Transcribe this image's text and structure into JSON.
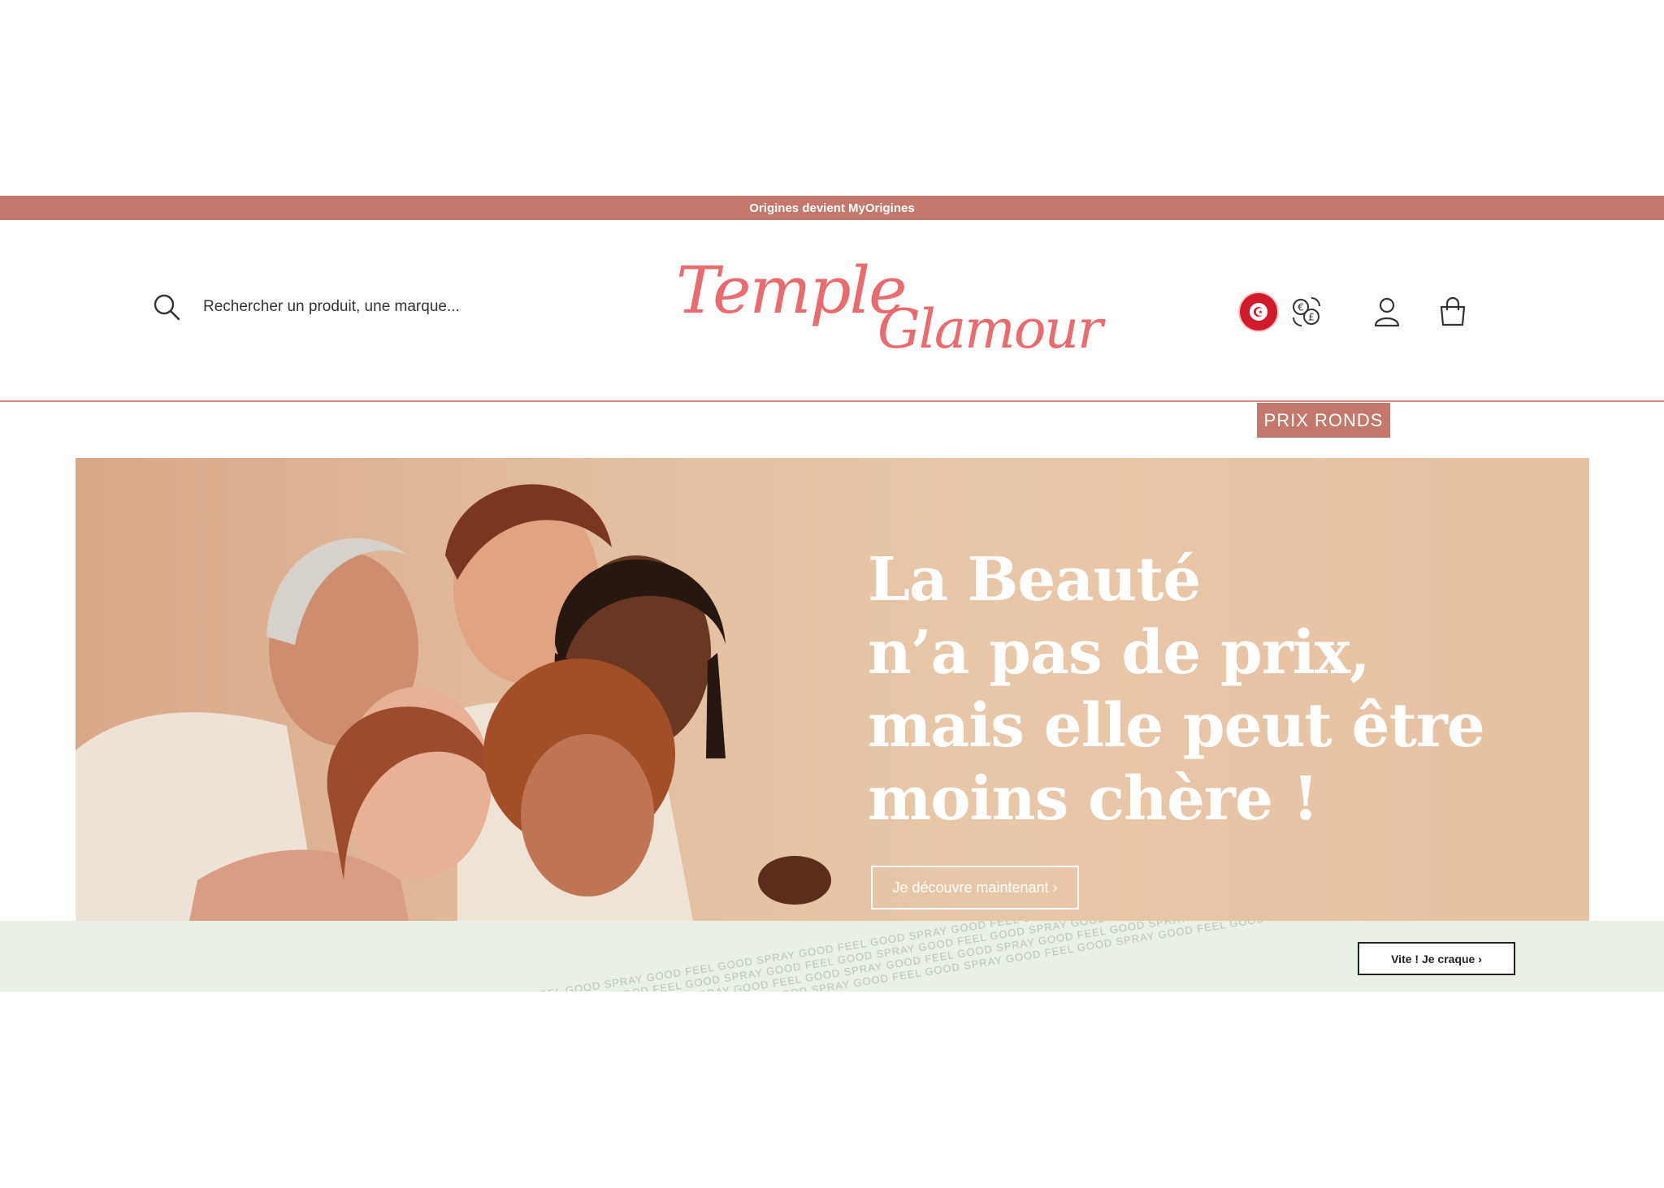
{
  "announcement": {
    "text": "Origines devient MyOrigines"
  },
  "header": {
    "search_placeholder": "Rechercher un produit, une marque...",
    "logo_line1": "Temple",
    "logo_line2": "Glamour"
  },
  "promo_tab": {
    "label": "PRIX RONDS"
  },
  "hero": {
    "headline_lines": [
      "La Beauté",
      "n’a pas de prix,",
      "mais elle peut être",
      "moins chère !"
    ],
    "cta_label": "Je découvre maintenant ›"
  },
  "strip": {
    "pattern_text": "SPRAY GOOD FEEL GOOD SPRAY GOOD FEEL GOOD SPRAY GOOD FEEL GOOD SPRAY GOOD FEEL GOOD SPRAY GOOD FEEL GOOD SPRAY GOOD FEEL GOOD SPRAY GOOD FEEL GOOD SPRAY GOOD FEEL GOOD SPRAY GOOD FEEL GOOD SPRAY GOOD FEEL GOOD SPRAY GOOD FEEL GOOD SPRAY GOOD FEEL GOOD",
    "cta_label": "Vite ! Je craque ›"
  },
  "icons": {
    "search": "search-icon",
    "flag": "tunisia-flag-icon",
    "currency": "currency-exchange-icon",
    "account": "user-icon",
    "cart": "shopping-bag-icon"
  },
  "colors": {
    "brand": "#c4776b",
    "logo": "#ea6b6f",
    "hero_bg": "#e2bfa0",
    "strip_bg": "#e9f0e6"
  }
}
